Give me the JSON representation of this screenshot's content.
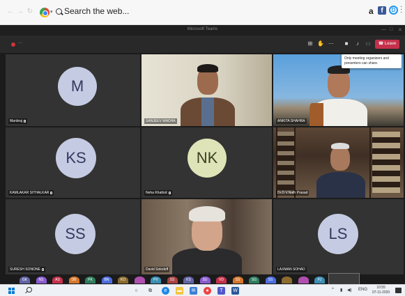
{
  "browser": {
    "search_placeholder": "Search the web..."
  },
  "teams": {
    "window_title": "Microsoft Teams",
    "leave_label": "Leave",
    "share_tooltip": "Only meeting organizers and presenters can share."
  },
  "tiles": [
    {
      "name": "Manbraj",
      "initials": "M",
      "kind": "avatar"
    },
    {
      "name": "SANJEEV WADHA",
      "kind": "video"
    },
    {
      "name": "ANKITA SHAHRA",
      "kind": "video"
    },
    {
      "name": "KAMLAKAR SITHALKAR",
      "initials": "KS",
      "kind": "avatar"
    },
    {
      "name": "Neha Khattod",
      "initials": "NK",
      "kind": "avatar"
    },
    {
      "name": "Dr.D.V.Nath Prasad",
      "kind": "video"
    },
    {
      "name": "SURESH SONONE",
      "initials": "SS",
      "kind": "avatar"
    },
    {
      "name": "David Sokoloff",
      "kind": "video"
    },
    {
      "name": "LAXMAN SOHAD",
      "initials": "LS",
      "kind": "avatar"
    }
  ],
  "strip": [
    "GK",
    "NS",
    "AS",
    "DB",
    "PK",
    "BN",
    "KO",
    "",
    "PV",
    "SS",
    "KS",
    "SU",
    "VD",
    "SS",
    "SG",
    "SS",
    "",
    "",
    "PJ"
  ],
  "taskbar": {
    "lang": "ENG",
    "time": "10:55",
    "date": "07-11-2020"
  },
  "colors": {
    "leave": "#c4314b",
    "avatar_bg": "#c5cbe2",
    "avatar_fg": "#333a5e",
    "stage": "#1b1b1b"
  }
}
